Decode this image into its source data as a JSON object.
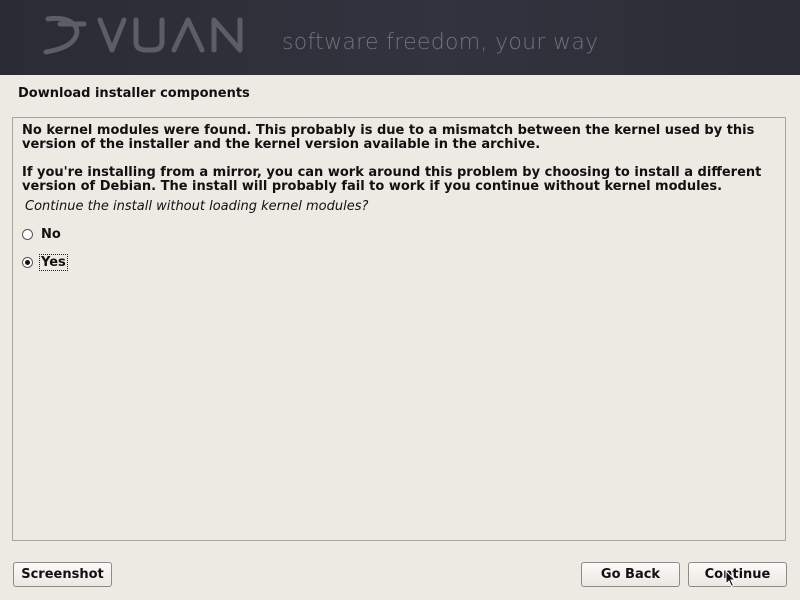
{
  "banner": {
    "logo_text": "DEVUAN",
    "tagline": "software freedom, your way"
  },
  "step_title": "Download installer components",
  "content": {
    "message_1": "No kernel modules were found. This probably is due to a mismatch between the kernel used by this version of the installer and the kernel version available in the archive.",
    "message_2": "If you're installing from a mirror, you can work around this problem by choosing to install a different version of Debian. The install will probably fail to work if you continue without kernel modules.",
    "question": "Continue the install without loading kernel modules?",
    "options": [
      {
        "label": "No",
        "selected": false
      },
      {
        "label": "Yes",
        "selected": true
      }
    ]
  },
  "buttons": {
    "screenshot": "Screenshot",
    "go_back": "Go Back",
    "continue": "Continue"
  },
  "icons": {
    "cursor": "arrow-cursor-icon"
  }
}
